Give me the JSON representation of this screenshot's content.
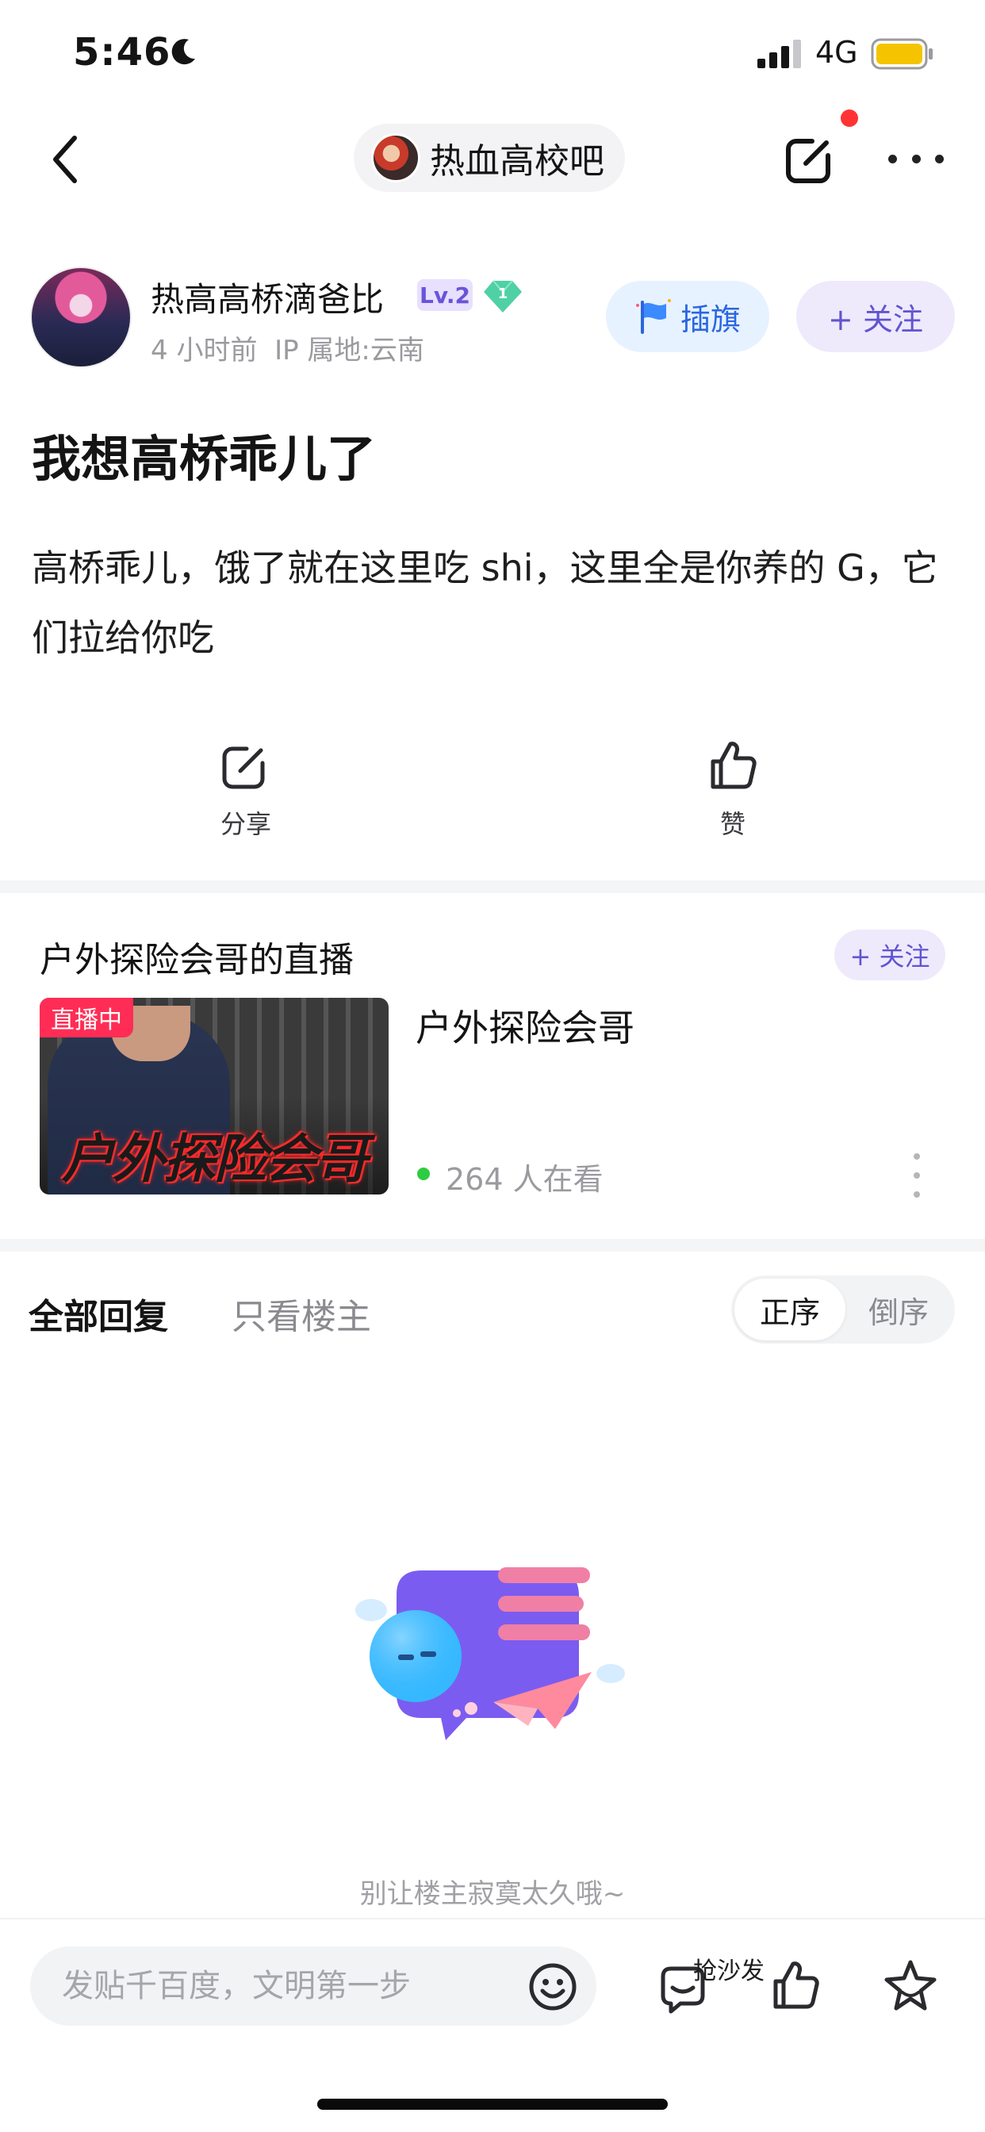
{
  "status_bar": {
    "time": "5:46",
    "network": "4G",
    "battery_color": "#f5c400"
  },
  "nav": {
    "forum_name": "热血高校吧",
    "has_notification": true
  },
  "author": {
    "name": "热高高桥滴爸比",
    "level": "Lv.2",
    "gem_level": "1",
    "time_ago": "4 小时前",
    "ip_location": "IP 属地:云南",
    "flag_button": "插旗",
    "follow_button": "+ 关注"
  },
  "post": {
    "title": "我想高桥乖儿了",
    "body": "高桥乖儿，饿了就在这里吃 shi，这里全是你养的 G，它们拉给你吃"
  },
  "actions": {
    "share_label": "分享",
    "like_label": "赞"
  },
  "live": {
    "header": "户外探险会哥的直播",
    "follow_label": "+ 关注",
    "badge": "直播中",
    "thumbnail_caption": "户外探险会哥",
    "streamer_name": "户外探险会哥",
    "viewers": "264 人在看"
  },
  "replies": {
    "tab_all": "全部回复",
    "tab_owner_only": "只看楼主",
    "sort_ascending": "正序",
    "sort_descending": "倒序",
    "sort_selected": "正序",
    "empty_text": "别让楼主寂寞太久哦~"
  },
  "bottom_bar": {
    "input_placeholder": "发贴千百度，文明第一步",
    "sofa_label": "抢沙发"
  },
  "colors": {
    "accent": "#6154d0",
    "live_red": "#ff2d55",
    "notification_red": "#ff3333",
    "flag_blue": "#2a66e0"
  }
}
